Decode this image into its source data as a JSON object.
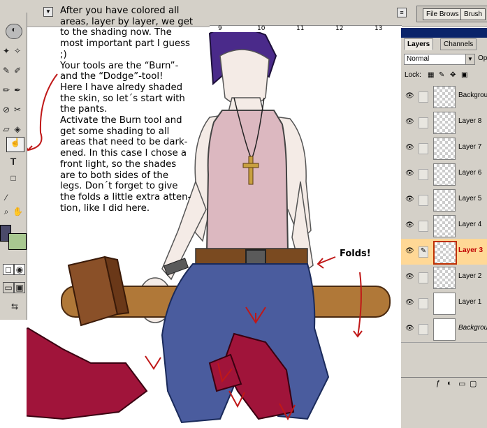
{
  "app": {
    "palette_well": [
      "File Brows",
      "Brush"
    ],
    "ruler_ticks": [
      "9",
      "10",
      "11",
      "12",
      "13"
    ]
  },
  "tutorial": {
    "lines": [
      "After you have colored all",
      "areas, layer by layer, we get",
      "to the shading now. The",
      "most important part I guess",
      ";)",
      "Your tools are the “Burn”-",
      "and the “Dodge”-tool!",
      "Here I have alredy shaded",
      "the skin, so let´s start with",
      "the pants.",
      "Activate the Burn tool and",
      "get some shading to all",
      "areas that need to be dark-",
      "ened. In this case I chose a",
      "front light, so the shades",
      "are to both sides of the",
      "legs. Don´t forget to give",
      "the folds a little extra atten-",
      "tion, like I did here."
    ],
    "annotation": "Folds!"
  },
  "layers_panel": {
    "tabs": [
      "Layers",
      "Channels"
    ],
    "active_tab": "Layers",
    "blend_mode": "Normal",
    "opacity_label": "Op",
    "lock_label": "Lock:",
    "layers": [
      {
        "name": "Backgrou",
        "visible": true,
        "selected": false
      },
      {
        "name": "Layer 8",
        "visible": true,
        "selected": false
      },
      {
        "name": "Layer 7",
        "visible": true,
        "selected": false
      },
      {
        "name": "Layer 6",
        "visible": true,
        "selected": false
      },
      {
        "name": "Layer 5",
        "visible": true,
        "selected": false
      },
      {
        "name": "Layer 4",
        "visible": true,
        "selected": false
      },
      {
        "name": "Layer 3",
        "visible": true,
        "selected": true
      },
      {
        "name": "Layer 2",
        "visible": true,
        "selected": false
      },
      {
        "name": "Layer 1",
        "visible": true,
        "selected": false
      },
      {
        "name": "Backgrou",
        "visible": true,
        "selected": false
      }
    ]
  },
  "colors": {
    "ui_gray": "#d4d0c8",
    "panel_title": "#0a246a",
    "selected_layer": "#ffd896",
    "annotation_red": "#c01818",
    "pants_blue": "#4a5c9e",
    "boots_red": "#a0143a",
    "top_pink": "#dcb8c0",
    "hair_purple": "#4a2a8a"
  }
}
